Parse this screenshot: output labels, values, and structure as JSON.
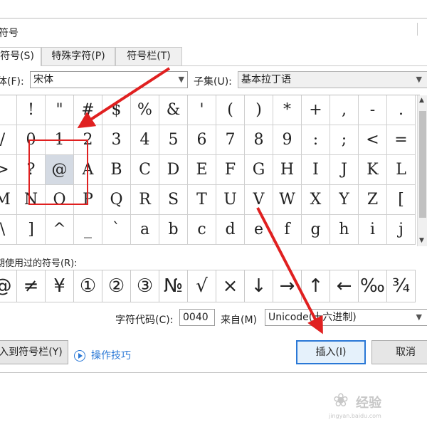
{
  "window": {
    "title": "符号"
  },
  "tabs": [
    {
      "label": "符号(S)",
      "active": true
    },
    {
      "label": "特殊字符(P)",
      "active": false
    },
    {
      "label": "符号栏(T)",
      "active": false
    }
  ],
  "font": {
    "label": "体(F):",
    "value": "宋体"
  },
  "subset": {
    "label": "子集(U):",
    "value": "基本拉丁语"
  },
  "symbol_rows": [
    [
      "",
      "!",
      "\"",
      "#",
      "$",
      "%",
      "&",
      "'",
      "(",
      ")",
      "*",
      "+",
      ",",
      "-",
      "."
    ],
    [
      "/",
      "0",
      "1",
      "2",
      "3",
      "4",
      "5",
      "6",
      "7",
      "8",
      "9",
      ":",
      ";",
      "<",
      "="
    ],
    [
      ">",
      "?",
      "@",
      "A",
      "B",
      "C",
      "D",
      "E",
      "F",
      "G",
      "H",
      "I",
      "J",
      "K",
      "L"
    ],
    [
      "M",
      "N",
      "O",
      "P",
      "Q",
      "R",
      "S",
      "T",
      "U",
      "V",
      "W",
      "X",
      "Y",
      "Z",
      "["
    ],
    [
      "\\",
      "]",
      "^",
      "_",
      "`",
      "a",
      "b",
      "c",
      "d",
      "e",
      "f",
      "g",
      "h",
      "i",
      "j"
    ]
  ],
  "selected_symbol": "@",
  "recent": {
    "label": "期使用过的符号(R):",
    "symbols": [
      "@",
      "≠",
      "¥",
      "①",
      "②",
      "③",
      "№",
      "√",
      "×",
      "↓",
      "→",
      "↑",
      "←",
      "‰",
      "¾"
    ]
  },
  "char_code": {
    "label": "字符代码(C):",
    "value": "0040"
  },
  "from": {
    "label": "来自(M)",
    "value": "Unicode(十六进制)"
  },
  "buttons": {
    "shortcut": "入到符号栏(Y)",
    "insert": "插入(I)",
    "cancel": "取消"
  },
  "tips": {
    "label": "操作技巧"
  },
  "watermark": {
    "brand": "经验",
    "url": "jingyan.baidu.com"
  },
  "colors": {
    "accent": "#2a78d6",
    "annotation": "#e02020",
    "selected_cell": "#d4dae3"
  },
  "icons": {
    "tips": "play-circle-icon",
    "dropdown": "chevron-down-icon"
  }
}
